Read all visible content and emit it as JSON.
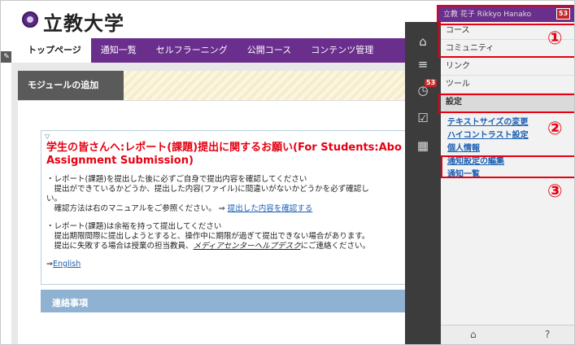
{
  "header": {
    "logo_text": "立教大学"
  },
  "nav": {
    "items": [
      "トップページ",
      "通知一覧",
      "セルフラーニング",
      "公開コース",
      "コンテンツ管理"
    ]
  },
  "module": {
    "label": "モジュールの追加"
  },
  "notice": {
    "title_line1": "学生の皆さんへ:レポート(課題)提出に関するお願い(For Students:Abo",
    "title_line2": "Assignment Submission)",
    "p1_line1": "・レポート(課題)を提出した後に必ずご自身で提出内容を確認してください",
    "p1_line2": "　提出ができているかどうか、提出した内容(ファイル)に間違いがないかどうかを必ず確認し",
    "p1_line3": "い。",
    "p1_line4": "　確認方法は右のマニュアルをご参照ください。 ⇒ ",
    "p1_link": "提出した内容を確認する",
    "p2_line1": "・レポート(課題)は余裕を持って提出してください",
    "p2_line2": "　提出期限間際に提出しようとすると、操作中に期限が過ぎて提出できない場合があります。",
    "p2_line3_pre": "　提出に失敗する場合は授業の担当教員、",
    "p2_link": "メディアセンターヘルプデスク",
    "p2_line3_post": "にご連絡ください。",
    "english_prefix": "⇒",
    "english_link": "English"
  },
  "contact": {
    "label": "連絡事項"
  },
  "topbar": {
    "user": "立教 花子 Rikkyo Hanako",
    "badge": "53"
  },
  "iconbar": {
    "clock_badge": "53"
  },
  "menu": {
    "items": [
      "コース",
      "コミュニティ",
      "リンク",
      "ツール",
      "設定"
    ]
  },
  "submenu": {
    "items": [
      "テキストサイズの変更",
      "ハイコントラスト設定",
      "個人情報",
      "通知設定の編集",
      "通知一覧"
    ]
  },
  "markers": {
    "m1": "①",
    "m2": "②",
    "m3": "③"
  },
  "footer": {
    "home_icon": "⌂",
    "help": "?"
  }
}
